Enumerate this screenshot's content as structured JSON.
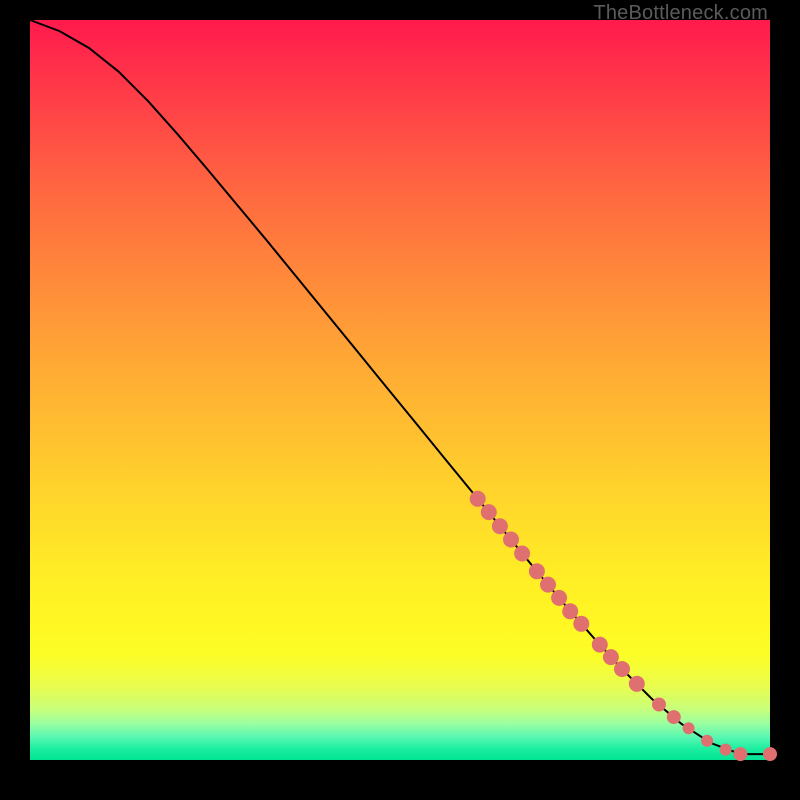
{
  "watermark": "TheBottleneck.com",
  "colors": {
    "curve": "#000000",
    "marker_fill": "#e07070",
    "marker_stroke": "#c85a5a"
  },
  "chart_data": {
    "type": "line",
    "title": "",
    "xlabel": "",
    "ylabel": "",
    "xlim": [
      0,
      100
    ],
    "ylim": [
      0,
      100
    ],
    "grid": false,
    "series": [
      {
        "name": "curve",
        "x": [
          0,
          4,
          8,
          12,
          16,
          20,
          24,
          28,
          32,
          36,
          40,
          44,
          48,
          52,
          56,
          60,
          64,
          68,
          72,
          76,
          80,
          84,
          88,
          92,
          96,
          100
        ],
        "y": [
          100,
          98.5,
          96.2,
          93.0,
          89.0,
          84.5,
          79.8,
          75.0,
          70.2,
          65.3,
          60.4,
          55.5,
          50.6,
          45.7,
          40.8,
          35.9,
          31.0,
          26.1,
          21.3,
          16.7,
          12.3,
          8.3,
          4.9,
          2.3,
          0.8,
          0.8
        ]
      }
    ],
    "markers": [
      {
        "x": 60.5,
        "y": 35.3,
        "r": 8
      },
      {
        "x": 62.0,
        "y": 33.5,
        "r": 8
      },
      {
        "x": 63.5,
        "y": 31.6,
        "r": 8
      },
      {
        "x": 65.0,
        "y": 29.8,
        "r": 8
      },
      {
        "x": 66.5,
        "y": 27.9,
        "r": 8
      },
      {
        "x": 68.5,
        "y": 25.5,
        "r": 8
      },
      {
        "x": 70.0,
        "y": 23.7,
        "r": 8
      },
      {
        "x": 71.5,
        "y": 21.9,
        "r": 8
      },
      {
        "x": 73.0,
        "y": 20.1,
        "r": 8
      },
      {
        "x": 74.5,
        "y": 18.4,
        "r": 8
      },
      {
        "x": 77.0,
        "y": 15.6,
        "r": 8
      },
      {
        "x": 78.5,
        "y": 13.9,
        "r": 8
      },
      {
        "x": 80.0,
        "y": 12.3,
        "r": 8
      },
      {
        "x": 82.0,
        "y": 10.3,
        "r": 8
      },
      {
        "x": 85.0,
        "y": 7.5,
        "r": 7
      },
      {
        "x": 87.0,
        "y": 5.8,
        "r": 7
      },
      {
        "x": 89.0,
        "y": 4.3,
        "r": 6
      },
      {
        "x": 91.5,
        "y": 2.6,
        "r": 6
      },
      {
        "x": 94.0,
        "y": 1.4,
        "r": 6
      },
      {
        "x": 96.0,
        "y": 0.8,
        "r": 7
      },
      {
        "x": 100.0,
        "y": 0.8,
        "r": 7
      }
    ]
  }
}
